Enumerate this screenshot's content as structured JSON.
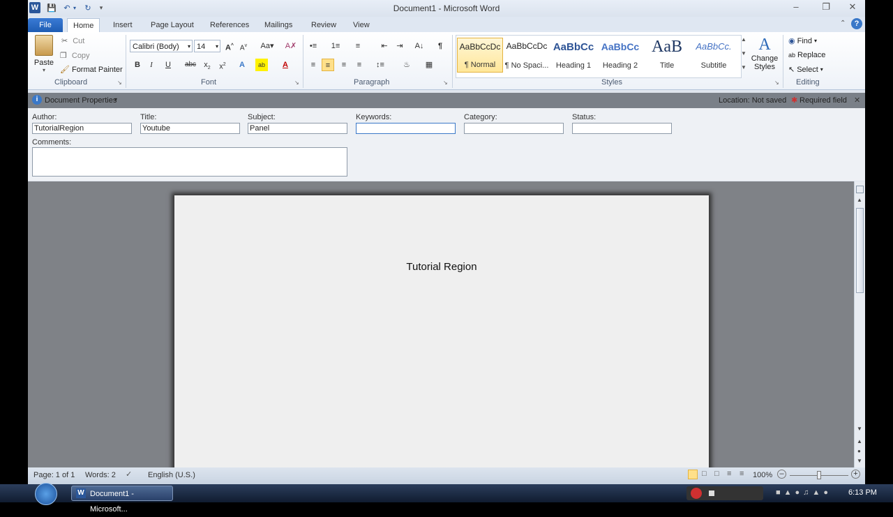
{
  "window": {
    "title": "Document1  -  Microsoft Word"
  },
  "tabs": [
    "File",
    "Home",
    "Insert",
    "Page Layout",
    "References",
    "Mailings",
    "Review",
    "View"
  ],
  "clipboard": {
    "paste": "Paste",
    "cut": "Cut",
    "copy": "Copy",
    "format_painter": "Format Painter",
    "label": "Clipboard"
  },
  "font": {
    "name": "Calibri (Body)",
    "size": "14",
    "label": "Font"
  },
  "paragraph": {
    "label": "Paragraph"
  },
  "styles": {
    "items": [
      {
        "preview": "AaBbCcDc",
        "label": "¶ Normal"
      },
      {
        "preview": "AaBbCcDc",
        "label": "¶ No Spaci..."
      },
      {
        "preview": "AaBbCc",
        "label": "Heading 1"
      },
      {
        "preview": "AaBbCc",
        "label": "Heading 2"
      },
      {
        "preview": "AaB",
        "label": "Title"
      },
      {
        "preview": "AaBbCc.",
        "label": "Subtitle"
      }
    ],
    "change_styles": "Change Styles",
    "label": "Styles"
  },
  "editing": {
    "find": "Find",
    "replace": "Replace",
    "select": "Select",
    "label": "Editing"
  },
  "doc_properties": {
    "bar_title": "Document Properties",
    "location": "Location: Not saved",
    "required": "Required field",
    "author_label": "Author:",
    "author_value": "TutorialRegion",
    "title_label": "Title:",
    "title_value": "Youtube",
    "subject_label": "Subject:",
    "subject_value": "Panel",
    "keywords_label": "Keywords:",
    "keywords_value": "",
    "category_label": "Category:",
    "category_value": "",
    "status_label": "Status:",
    "status_value": "",
    "comments_label": "Comments:",
    "comments_value": ""
  },
  "document": {
    "body_text": "Tutorial Region"
  },
  "status_bar": {
    "page": "Page: 1 of 1",
    "words": "Words: 2",
    "language": "English (U.S.)",
    "zoom": "100%"
  },
  "taskbar": {
    "item": "Document1 - Microsoft...",
    "time": "6:13 PM"
  }
}
